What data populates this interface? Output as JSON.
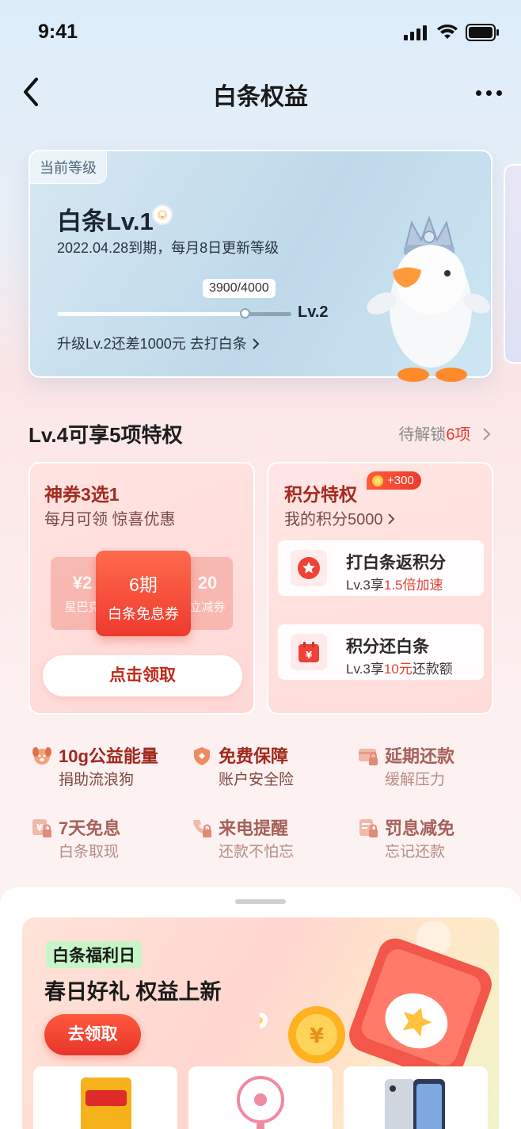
{
  "status_bar": {
    "time": "9:41"
  },
  "nav": {
    "title": "白条权益"
  },
  "level_card": {
    "badge": "当前等级",
    "level_name": "白条Lv.1",
    "expire_text": "2022.04.28到期，每月8日更新等级",
    "progress_text": "3900/4000",
    "progress_ratio": 0.975,
    "next_level": "Lv.2",
    "upgrade_text": "升级Lv.2还差1000元 去打白条"
  },
  "privileges": {
    "title": "Lv.4可享5项特权",
    "pending_prefix": "待解锁",
    "pending_count": "6项"
  },
  "coupon_card": {
    "title": "神券3选1",
    "subtitle": "每月可领 惊喜优惠",
    "side_left_value": "¥2",
    "side_left_label": "星巴克",
    "side_right_value": "20",
    "side_right_label": "立减券",
    "main_period": "6期",
    "main_label": "白条免息券",
    "button": "点击领取"
  },
  "points_card": {
    "title": "积分特权",
    "badge": "+300",
    "subtitle": "我的积分5000",
    "items": [
      {
        "title": "打白条返积分",
        "prefix": "Lv.3享",
        "highlight": "1.5倍加速",
        "suffix": ""
      },
      {
        "title": "积分还白条",
        "prefix": "Lv.3享",
        "highlight": "10元",
        "suffix": "还款额"
      }
    ]
  },
  "grid": [
    {
      "title": "10g公益能量",
      "sub": "捐助流浪狗",
      "icon": "dog-icon"
    },
    {
      "title": "免费保障",
      "sub": "账户安全险",
      "icon": "shield-icon"
    },
    {
      "title": "延期还款",
      "sub": "缓解压力",
      "icon": "card-lock-icon"
    },
    {
      "title": "7天免息",
      "sub": "白条取现",
      "icon": "yen-lock-icon"
    },
    {
      "title": "来电提醒",
      "sub": "还款不怕忘",
      "icon": "phone-lock-icon"
    },
    {
      "title": "罚息减免",
      "sub": "忘记还款",
      "icon": "doc-lock-icon"
    }
  ],
  "banner": {
    "tag": "白条福利日",
    "title": "春日好礼 权益上新",
    "button": "去领取"
  },
  "colors": {
    "accent": "#e8352a",
    "primary_text": "#1a1a1a"
  }
}
